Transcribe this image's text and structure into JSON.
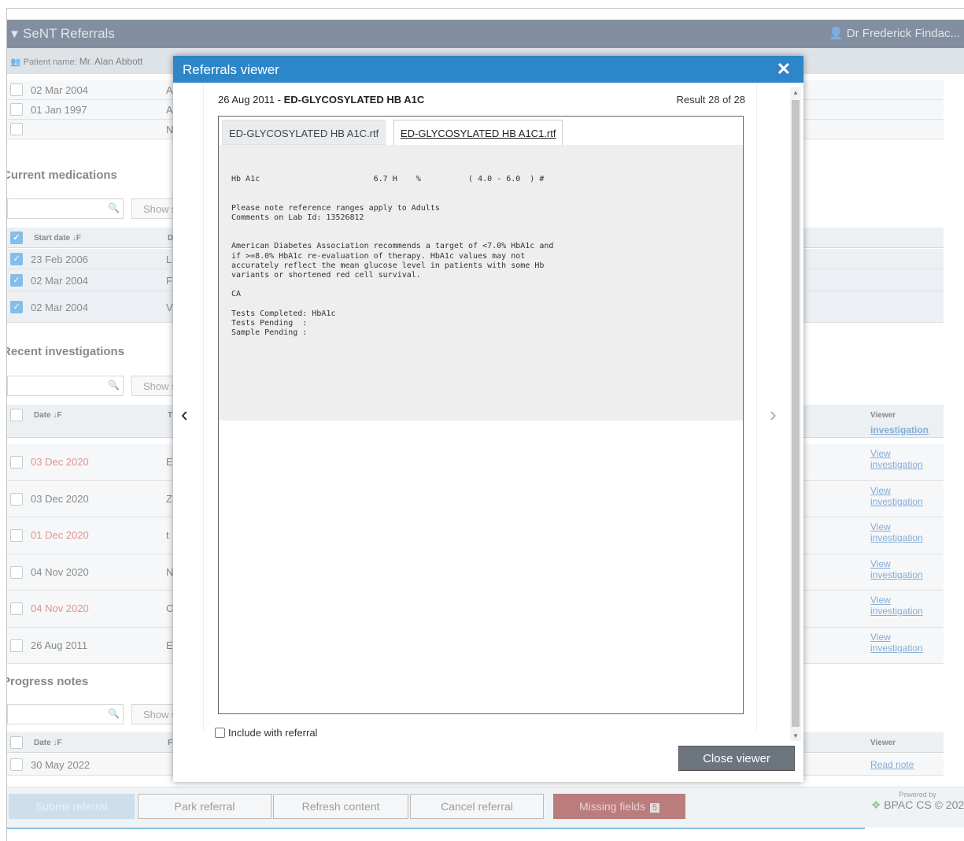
{
  "app": {
    "title": "SeNT Referrals",
    "user": "Dr Frederick Findac..."
  },
  "patient": {
    "label": "Patient name:",
    "name": "Mr. Alan Abbott"
  },
  "top_rows": [
    {
      "date": "02 Mar 2004",
      "col2": "A"
    },
    {
      "date": "01 Jan 1997",
      "col2": "A"
    },
    {
      "date": "",
      "col2": "N"
    }
  ],
  "medications": {
    "title": "Current medications",
    "show_label": "Show s",
    "header": {
      "date": "Start date ↓F",
      "col2": "D"
    },
    "rows": [
      {
        "date": "23 Feb 2006",
        "col2": "L"
      },
      {
        "date": "02 Mar 2004",
        "col2": "F"
      },
      {
        "date": "02 Mar 2004",
        "col2": "V"
      }
    ]
  },
  "investigations": {
    "title": "Recent investigations",
    "show_label": "Show s",
    "header": {
      "date": "Date ↓F",
      "col2": "T",
      "viewer": "Viewer"
    },
    "first_link": "investigation",
    "rows": [
      {
        "date": "03 Dec 2020",
        "col2": "E",
        "link1": "View",
        "link2": "investigation",
        "red": true
      },
      {
        "date": "03 Dec 2020",
        "col2": "Z",
        "link1": "View",
        "link2": "investigation",
        "red": false
      },
      {
        "date": "01 Dec 2020",
        "col2": "t",
        "link1": "View",
        "link2": "investigation",
        "red": true
      },
      {
        "date": "04 Nov 2020",
        "col2": "N",
        "link1": "View",
        "link2": "investigation",
        "red": false
      },
      {
        "date": "04 Nov 2020",
        "col2": "C",
        "link1": "View",
        "link2": "investigation",
        "red": true
      },
      {
        "date": "26 Aug 2011",
        "col2": "E",
        "link1": "View",
        "link2": "investigation",
        "red": false
      }
    ]
  },
  "progress": {
    "title": "Progress notes",
    "show_label": "Show s",
    "header": {
      "date": "Date ↓F",
      "col2": "F",
      "viewer": "Viewer"
    },
    "rows": [
      {
        "date": "30 May 2022",
        "link": "Read note"
      }
    ]
  },
  "footer": {
    "submit": "Submit referral",
    "park": "Park referral",
    "refresh": "Refresh content",
    "cancel": "Cancel referral",
    "missing": "Missing fields",
    "missing_count": "5",
    "powered_by": "Powered by",
    "brand": "BPAC CS © 202"
  },
  "modal": {
    "title": "Referrals viewer",
    "close_glyph": "✕",
    "date": "26 Aug 2011 - ",
    "test_name": "ED-GLYCOSYLATED HB A1C",
    "result_count": "Result 28 of 28",
    "tabs": [
      "ED-GLYCOSYLATED HB A1C.rtf",
      "ED-GLYCOSYLATED HB A1C1.rtf"
    ],
    "document_text": "Hb A1c                        6.7 H    %          ( 4.0 - 6.0  ) #\n\n\nPlease note reference ranges apply to Adults\nComments on Lab Id: 13526812\n\n\nAmerican Diabetes Association recommends a target of <7.0% HbA1c and\nif >=8.0% HbA1c re-evaluation of therapy. HbA1c values may not\naccurately reflect the mean glucose level in patients with some Hb\nvariants or shortened red cell survival.\n\nCA\n\nTests Completed: HbA1c\nTests Pending  :\nSample Pending :",
    "include_label": "Include with referral",
    "close_button": "Close viewer",
    "prev_glyph": "‹",
    "next_glyph": "›"
  }
}
